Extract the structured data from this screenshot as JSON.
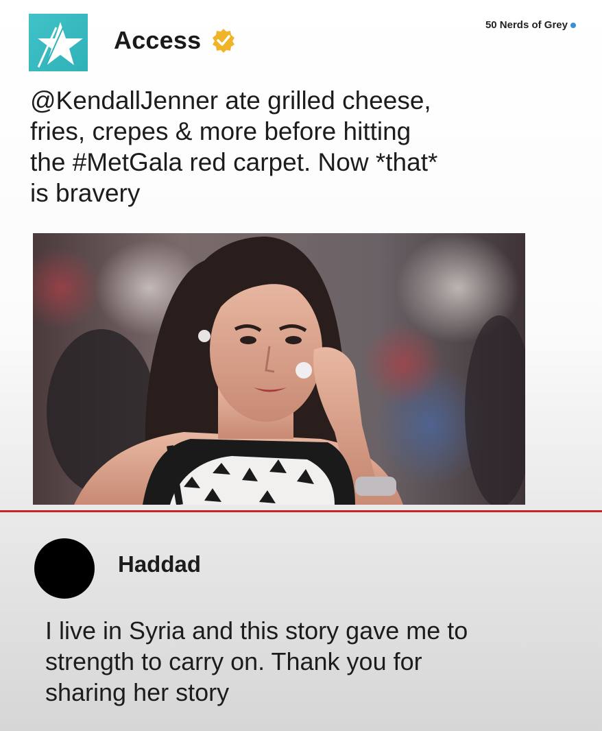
{
  "post": {
    "account_name": "Access",
    "verified": true,
    "watermark": "50 Nerds of Grey",
    "text": "@KendallJenner ate grilled cheese,\nfries, crepes & more before hitting\nthe #MetGala red carpet. Now *that*\nis bravery",
    "logo_icon": "star-icon",
    "brand_color": "#3bbcc3",
    "badge_color": "#f0b429"
  },
  "reply": {
    "author": "Haddad",
    "text": "I live in Syria and this story gave me to\nstrength to carry on. Thank you for\nsharing her story"
  },
  "divider_color": "#c5262c"
}
